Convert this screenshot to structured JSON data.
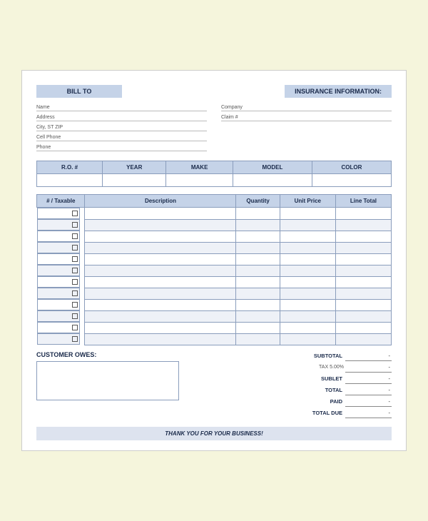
{
  "header": {
    "bill_to_label": "BILL TO",
    "insurance_label": "INSURANCE INFORMATION:"
  },
  "bill_to": {
    "name_label": "Name",
    "address_label": "Address",
    "city_label": "City, ST ZIP",
    "cell_label": "Cell Phone",
    "phone_label": "Phone"
  },
  "insurance": {
    "company_label": "Company",
    "claim_label": "Claim #"
  },
  "vehicle_table": {
    "headers": [
      "R.O. #",
      "YEAR",
      "MAKE",
      "MODEL",
      "COLOR"
    ]
  },
  "items_table": {
    "headers": [
      "# / Taxable",
      "Description",
      "Quantity",
      "Unit Price",
      "Line Total"
    ],
    "rows": 12
  },
  "totals": {
    "subtotal_label": "SUBTOTAL",
    "tax_label": "TAX",
    "tax_rate": "5.00%",
    "sublet_label": "SUBLET",
    "total_label": "TOTAL",
    "paid_label": "PAID",
    "total_due_label": "TOTAL DUE",
    "dash": "-"
  },
  "customer_owes": {
    "label": "CUSTOMER OWES:"
  },
  "footer": {
    "text": "THANK YOU FOR YOUR BUSINESS!"
  }
}
